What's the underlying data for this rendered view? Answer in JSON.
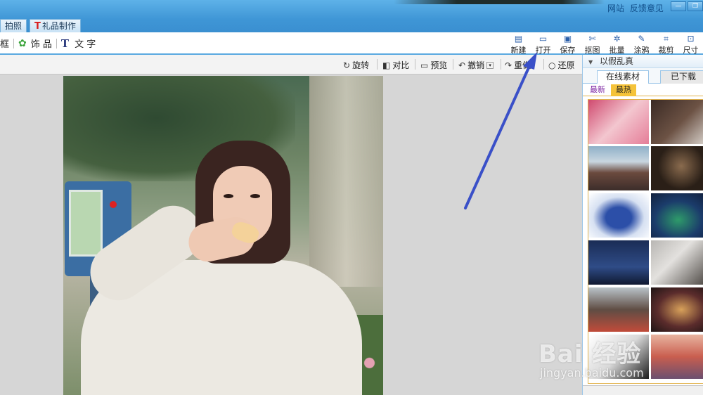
{
  "header": {
    "top_links": [
      "网站",
      "反馈意见"
    ],
    "tabs": [
      {
        "label": "拍照",
        "has_icon": false
      },
      {
        "label": "礼品制作",
        "has_icon": true,
        "icon": "T"
      }
    ]
  },
  "toolbar": {
    "left": [
      {
        "label": "框"
      },
      {
        "label": "饰 品",
        "icon": "ornament-icon"
      },
      {
        "label": "文 字",
        "icon": "text-T-icon",
        "glyph": "T"
      }
    ],
    "right": [
      {
        "label": "新建",
        "icon": "new-file-icon",
        "glyph": "▤"
      },
      {
        "label": "打开",
        "icon": "open-folder-icon",
        "glyph": "▭"
      },
      {
        "label": "保存",
        "icon": "save-disk-icon",
        "glyph": "▣"
      },
      {
        "label": "抠图",
        "icon": "cutout-icon",
        "glyph": "✄"
      },
      {
        "label": "批量",
        "icon": "batch-gear-icon",
        "glyph": "✲"
      },
      {
        "label": "涂鸦",
        "icon": "graffiti-icon",
        "glyph": "✎"
      },
      {
        "label": "裁剪",
        "icon": "crop-icon",
        "glyph": "⌗"
      },
      {
        "label": "尺寸",
        "icon": "resize-icon",
        "glyph": "⊡"
      }
    ]
  },
  "subbar": {
    "rotate": {
      "label": "旋转",
      "glyph": "↻"
    },
    "compare": {
      "label": "对比",
      "glyph": "◧"
    },
    "preview": {
      "label": "预览",
      "glyph": "▭"
    },
    "undo": {
      "label": "撤销",
      "glyph": "↶"
    },
    "redo": {
      "label": "重做",
      "glyph": "↷"
    },
    "restore": {
      "label": "还原",
      "glyph": "○"
    }
  },
  "panel": {
    "title": "以假乱真",
    "source_tabs": [
      "在线素材",
      "已下载"
    ],
    "sub_tabs": [
      "最新",
      "最热"
    ],
    "active_sub_tab": "最热"
  },
  "watermark": {
    "main": "Bai 经验",
    "sub": "jingyan.baidu.com"
  },
  "colors": {
    "accent": "#3f96d6",
    "arrow": "#3a50c8",
    "hot_tab": "#f5c33a"
  }
}
